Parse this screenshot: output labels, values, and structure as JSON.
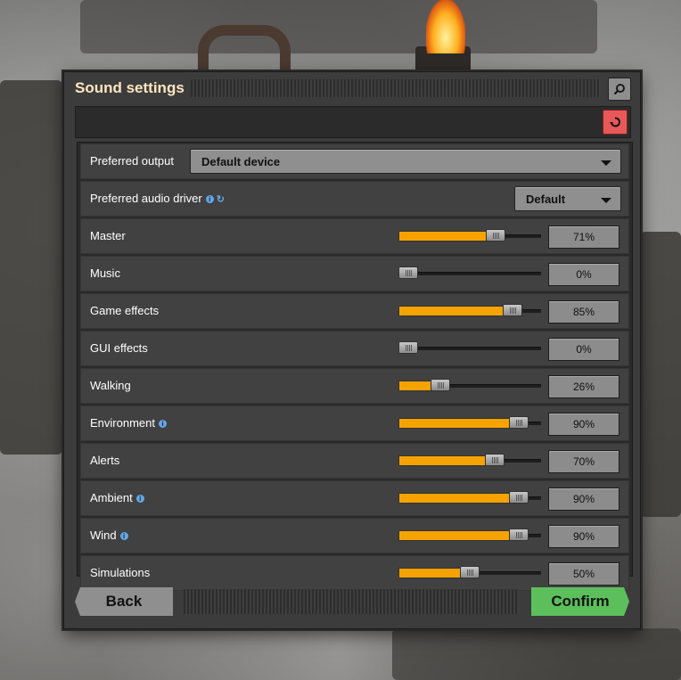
{
  "window": {
    "title": "Sound settings"
  },
  "icons": {
    "search": "search-icon",
    "reset": "reset-icon",
    "info": "info-icon",
    "refresh": "refresh-icon",
    "dropdown": "chevron-down-icon"
  },
  "colors": {
    "accent": "#f6a300",
    "reset": "#e85858",
    "confirm": "#5cbf5c",
    "title": "#ffe6c0",
    "info": "#64a7e6"
  },
  "preferred_output": {
    "label": "Preferred output",
    "value": "Default device"
  },
  "preferred_audio_driver": {
    "label": "Preferred audio driver",
    "value": "Default"
  },
  "sliders": [
    {
      "label": "Master",
      "value": 71,
      "display": "71%",
      "info": false
    },
    {
      "label": "Music",
      "value": 0,
      "display": "0%",
      "info": false
    },
    {
      "label": "Game effects",
      "value": 85,
      "display": "85%",
      "info": false
    },
    {
      "label": "GUI effects",
      "value": 0,
      "display": "0%",
      "info": false
    },
    {
      "label": "Walking",
      "value": 26,
      "display": "26%",
      "info": false
    },
    {
      "label": "Environment",
      "value": 90,
      "display": "90%",
      "info": true
    },
    {
      "label": "Alerts",
      "value": 70,
      "display": "70%",
      "info": false
    },
    {
      "label": "Ambient",
      "value": 90,
      "display": "90%",
      "info": true
    },
    {
      "label": "Wind",
      "value": 90,
      "display": "90%",
      "info": true
    },
    {
      "label": "Simulations",
      "value": 50,
      "display": "50%",
      "info": false
    }
  ],
  "footer": {
    "back_label": "Back",
    "confirm_label": "Confirm"
  }
}
